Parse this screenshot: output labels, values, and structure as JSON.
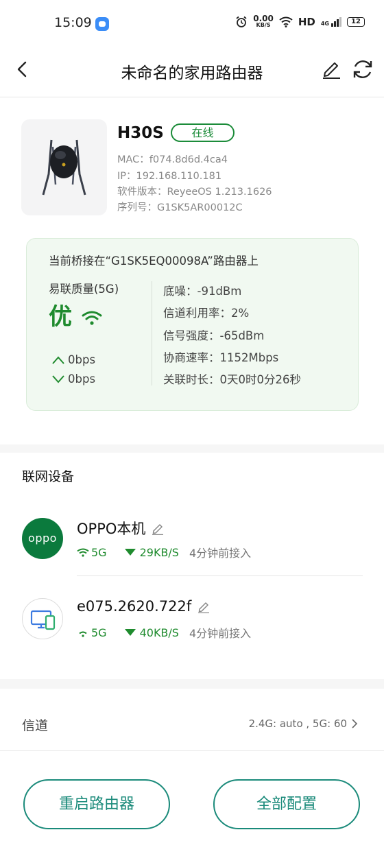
{
  "status_bar": {
    "time": "15:09",
    "net_speed_value": "0.00",
    "net_speed_unit": "KB/S",
    "hd_label": "HD",
    "network_type": "4G",
    "battery": "12"
  },
  "nav": {
    "title": "未命名的家用路由器"
  },
  "device": {
    "name": "H30S",
    "status": "在线",
    "mac": "MAC：f074.8d6d.4ca4",
    "ip": "IP：192.168.110.181",
    "firmware": "软件版本：ReyeeOS 1.213.1626",
    "serial": "序列号：G1SK5AR00012C"
  },
  "bridge": {
    "title": "当前桥接在“G1SK5EQ00098A”路由器上",
    "quality_label": "易联质量(5G)",
    "quality_value": "优",
    "upload": "0bps",
    "download": "0bps",
    "noise": "底噪：-91dBm",
    "channel_util": "信道利用率：2%",
    "signal": "信号强度：-65dBm",
    "negotiated_rate": "协商速率：1152Mbps",
    "assoc_time": "关联时长：0天0时0分26秒"
  },
  "connected": {
    "title": "联网设备",
    "items": [
      {
        "avatar_text": "oppo",
        "name": "OPPO本机",
        "band": "5G",
        "speed": "29KB/S",
        "time": "4分钟前接入"
      },
      {
        "name": "e075.2620.722f",
        "band": "5G",
        "speed": "40KB/S",
        "time": "4分钟前接入"
      }
    ]
  },
  "channel": {
    "label": "信道",
    "value": "2.4G: auto , 5G: 60"
  },
  "actions": {
    "reboot": "重启路由器",
    "config": "全部配置"
  },
  "colors": {
    "green": "#1f8b2e",
    "teal": "#1a8a7a",
    "oppo_green": "#0b7a3d"
  }
}
